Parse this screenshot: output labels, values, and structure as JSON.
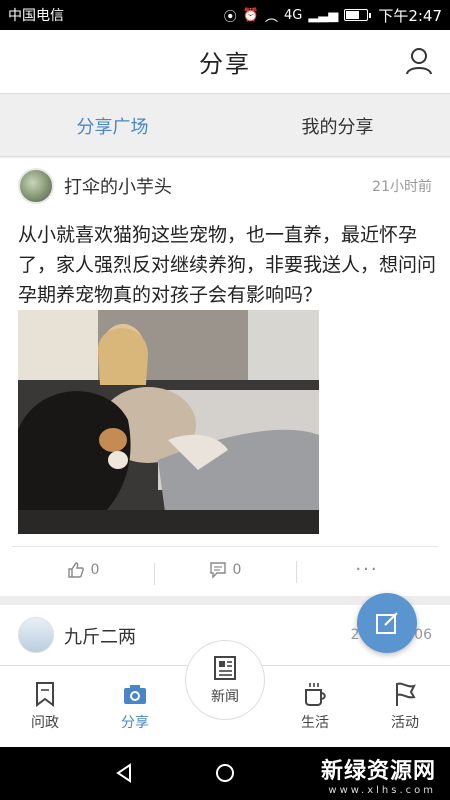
{
  "status_bar": {
    "carrier": "中国电信",
    "time": "下午2:47",
    "network_label": "4G",
    "battery_level": 0.7
  },
  "header": {
    "title": "分享",
    "profile_icon": "user-icon"
  },
  "tabs": [
    {
      "label": "分享广场",
      "active": true
    },
    {
      "label": "我的分享",
      "active": false
    }
  ],
  "post": {
    "author": "打伞的小芋头",
    "time": "21小时前",
    "text": "从小就喜欢猫狗这些宠物，也一直养，最近怀孕了，家人强烈反对继续养狗，非要我送人，想问问孕期养宠物真的对孩子会有影响吗？",
    "like_count": "0",
    "comment_count": "0",
    "more_label": "···"
  },
  "post2": {
    "author": "九斤二两",
    "time": "2018-05-06"
  },
  "fab_icon": "edit-icon",
  "bottom_nav": [
    {
      "label": "问政",
      "icon": "bookmark-icon",
      "active": false
    },
    {
      "label": "分享",
      "icon": "camera-icon",
      "active": true
    },
    {
      "label": "新闻",
      "icon": "newspaper-icon",
      "active": false
    },
    {
      "label": "生活",
      "icon": "cup-icon",
      "active": false
    },
    {
      "label": "活动",
      "icon": "flag-icon",
      "active": false
    }
  ],
  "watermark": {
    "title": "新绿资源网",
    "url": "www.xlhs.com"
  },
  "colors": {
    "accent": "#4a86c5",
    "fab": "#5b95cf"
  }
}
